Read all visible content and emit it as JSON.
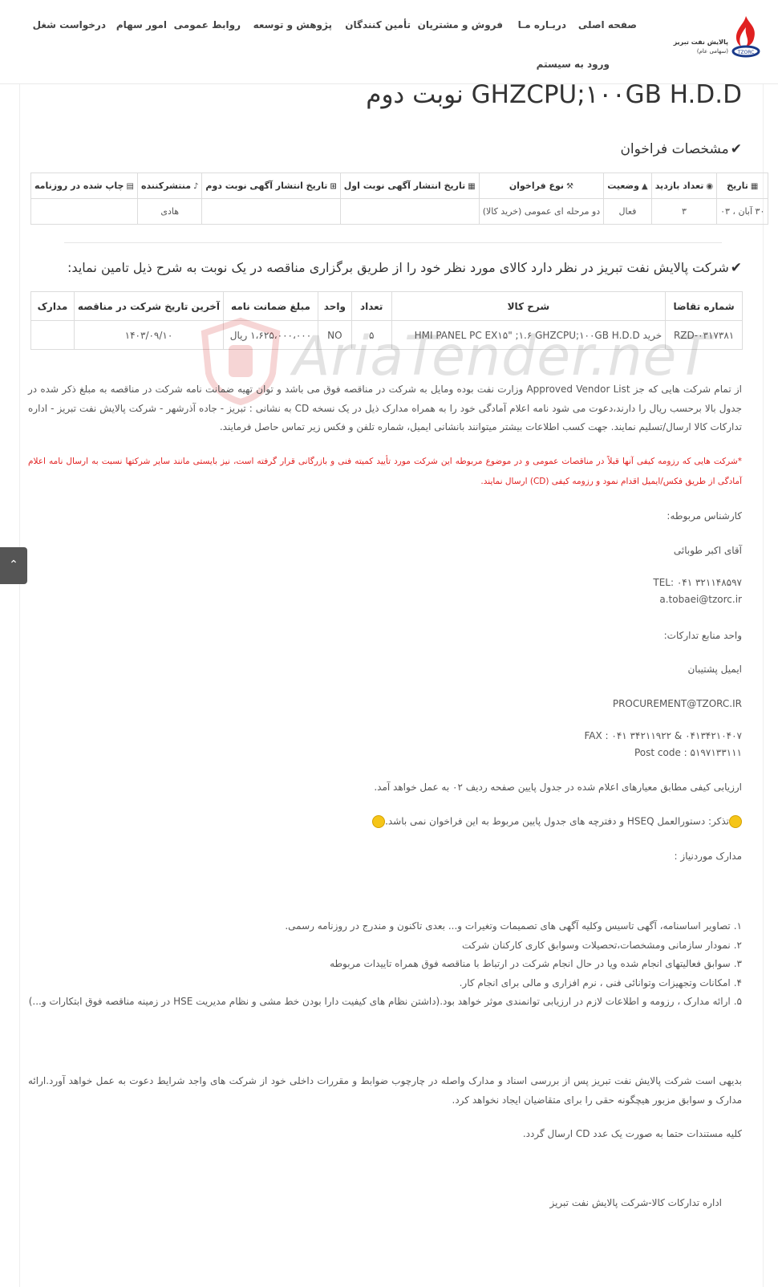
{
  "header": {
    "logo": {
      "text_1": "پالایش نفت تبریز",
      "text_2": "(سهامی عام)",
      "brand": "TZORC",
      "brand_color": "#e02020"
    },
    "nav": [
      {
        "label": "صفحه اصلی"
      },
      {
        "label": "دربـاره مـا"
      },
      {
        "label": "فروش و مشتریان"
      },
      {
        "label": "تأمین کنندگان"
      },
      {
        "label": "پژوهش و توسعه"
      },
      {
        "label": "روابط عمومی"
      },
      {
        "label": "امور سهام"
      },
      {
        "label": "درخواست شغل"
      },
      {
        "label": "ورود به سیستم"
      }
    ]
  },
  "main": {
    "title": "GHZCPU;۱۰۰GB H.D.D نوبت دوم",
    "specs_heading": "مشخصات فراخوان",
    "specs_table": {
      "headers": [
        "تاریخ",
        "تعداد بازدید",
        "وضعیت",
        "نوع فراخوان",
        "تاریخ انتشار آگهی نوبت اول",
        "تاریخ انتشار آگهی نوبت دوم",
        "منتشرکننده",
        "چاپ شده در روزنامه"
      ],
      "header_icons": [
        "calendar-icon",
        "eye-icon",
        "warning-icon",
        "gavel-icon",
        "calendar-icon",
        "calendar-plus-icon",
        "bell-icon",
        "newspaper-icon"
      ],
      "row": [
        "۳۰ آبان ، ۰۳",
        "۳",
        "فعال",
        "دو مرحله ای عمومی (خرید کالا)",
        "",
        "",
        "هادی",
        ""
      ]
    },
    "intro_heading": "شرکت پالایش نفت تبریز در نظر دارد کالای مورد نظر خود را از طریق برگزاری مناقصه در یک نوبت به شرح ذیل تامین نماید:",
    "items_table": {
      "headers": [
        "شماره تقاضا",
        "شرح کالا",
        "تعداد",
        "واحد",
        "مبلغ ضمانت نامه",
        "آخرین تاریخ شرکت در مناقصه",
        "مدارک"
      ],
      "row": [
        "RZD-۰۳۱۷۳۸۱",
        "خرید HMI PANEL PC EX۱۵\" ;۱.۶ GHZCPU;۱۰۰GB H.D.D",
        "۵",
        "NO",
        "۱،۶۲۵،۰۰۰،۰۰۰ ریال",
        "۱۴۰۳/۰۹/۱۰",
        ""
      ]
    },
    "watermark": "AriaTender.neT",
    "body_para": "از تمام شرکت هایی که جز Approved Vendor List وزارت نفت بوده ومایل به شرکت در مناقصه فوق می باشد و توان تهیه ضمانت نامه شرکت در مناقصه به مبلغ ذکر شده در جدول بالا برحسب ریال را دارند،دعوت می شود نامه اعلام آمادگی خود را به همراه مدارک ذیل در یک نسخه CD به نشانی : تبریز - جاده آذرشهر - شرکت پالایش نفت تبریز - اداره تدارکات کالا ارسال/تسلیم نمایند. جهت کسب اطلاعات بیشتر میتوانند بانشانی ایمیل، شماره تلفن و فکس زیر تماس حاصل فرمایند.",
    "red_note": "*شرکت هایی که رزومه کیفی آنها قبلاً در مناقصات عمومی و در موضوع مربوطه  این شرکت مورد تأیید کمیته فنی و بازرگانی قرار گرفته است، نیز بایستی مانند سایر شرکتها نسبت به ارسال نامه اعلام آمادگی از طریق فکس/ایمیل اقدام نمود و رزومه کیفی  (CD) ارسال نمایند.",
    "contact": {
      "expert_label": "کارشناس مربوطه:",
      "expert_name": "آقای اکبر طوبائی",
      "tel": "TEL: ۰۴۱ ۳۲۱۱۴۸۵۹۷",
      "email": "a.tobaei@tzorc.ir",
      "unit_label": "واحد منابع تدارکات:",
      "support_label": "ایمیل پشتیبان",
      "procurement_email": "PROCUREMENT@TZORC.IR",
      "fax": "FAX : ۰۴۱ ۳۴۲۱۱۹۲۲ & ۰۴۱۳۴۲۱۰۴۰۷",
      "postcode": "Post code : ۵۱۹۷۱۳۳۱۱۱"
    },
    "evaluation": "ارزیابی کیفی مطابق معیارهای اعلام شده در جدول پایین صفحه ردیف ۰۲ به عمل خواهد آمد.",
    "reminder": "تذکر: دستورالعمل HSEQ و دفترچه های جدول پایین مربوط به این فراخوان نمی باشد.",
    "docs_label": "مدارک موردنیاز :",
    "docs": [
      {
        "num": "۱.",
        "text": "تصاویر اساسنامه، آگهی تاسیس وکلیه آگهی های تصمیمات وتغیرات و... بعدی تاکنون و مندرج در روزنامه رسمی."
      },
      {
        "num": "۲.",
        "text": "نمودار سازمانی ومشخصات،تحصیلات وسوابق کاری کارکنان شرکت"
      },
      {
        "num": "۳.",
        "text": "سوابق فعالیتهای انجام شده ویا در حال انجام شرکت در ارتباط با مناقصه فوق همراه تاییدات مربوطه"
      },
      {
        "num": "۴.",
        "text": "امکانات وتجهیزات وتوانائی فنی ، نرم افزاری و مالی برای انجام کار."
      },
      {
        "num": "۵.",
        "text": "ارائه مدارک ، رزومه و اطلاعات لازم در ارزیابی توانمندی موثر خواهد بود.(داشتن نظام های کیفیت دارا بودن خط مشی و نظام  مدیریت HSE در زمینه مناقصه فوق ابتکارات و...)"
      }
    ],
    "closing_para": "بدیهی است شرکت پالایش نفت تبریز پس از بررسی اسناد و مدارک واصله در چارچوب ضوابط و مقررات داخلی خود از شرکت های واجد شرایط دعوت به عمل خواهد آورد.ارائه مدارک و سوابق مزبور هیچگونه حقی را برای متقاضیان ایجاد نخواهد کرد.",
    "cd_note": "کلیه مستندات حتما  به صورت یک عدد CD ارسال گردد.",
    "signature": "اداره تدارکات کالا-شرکت پالایش نفت تبریز"
  }
}
